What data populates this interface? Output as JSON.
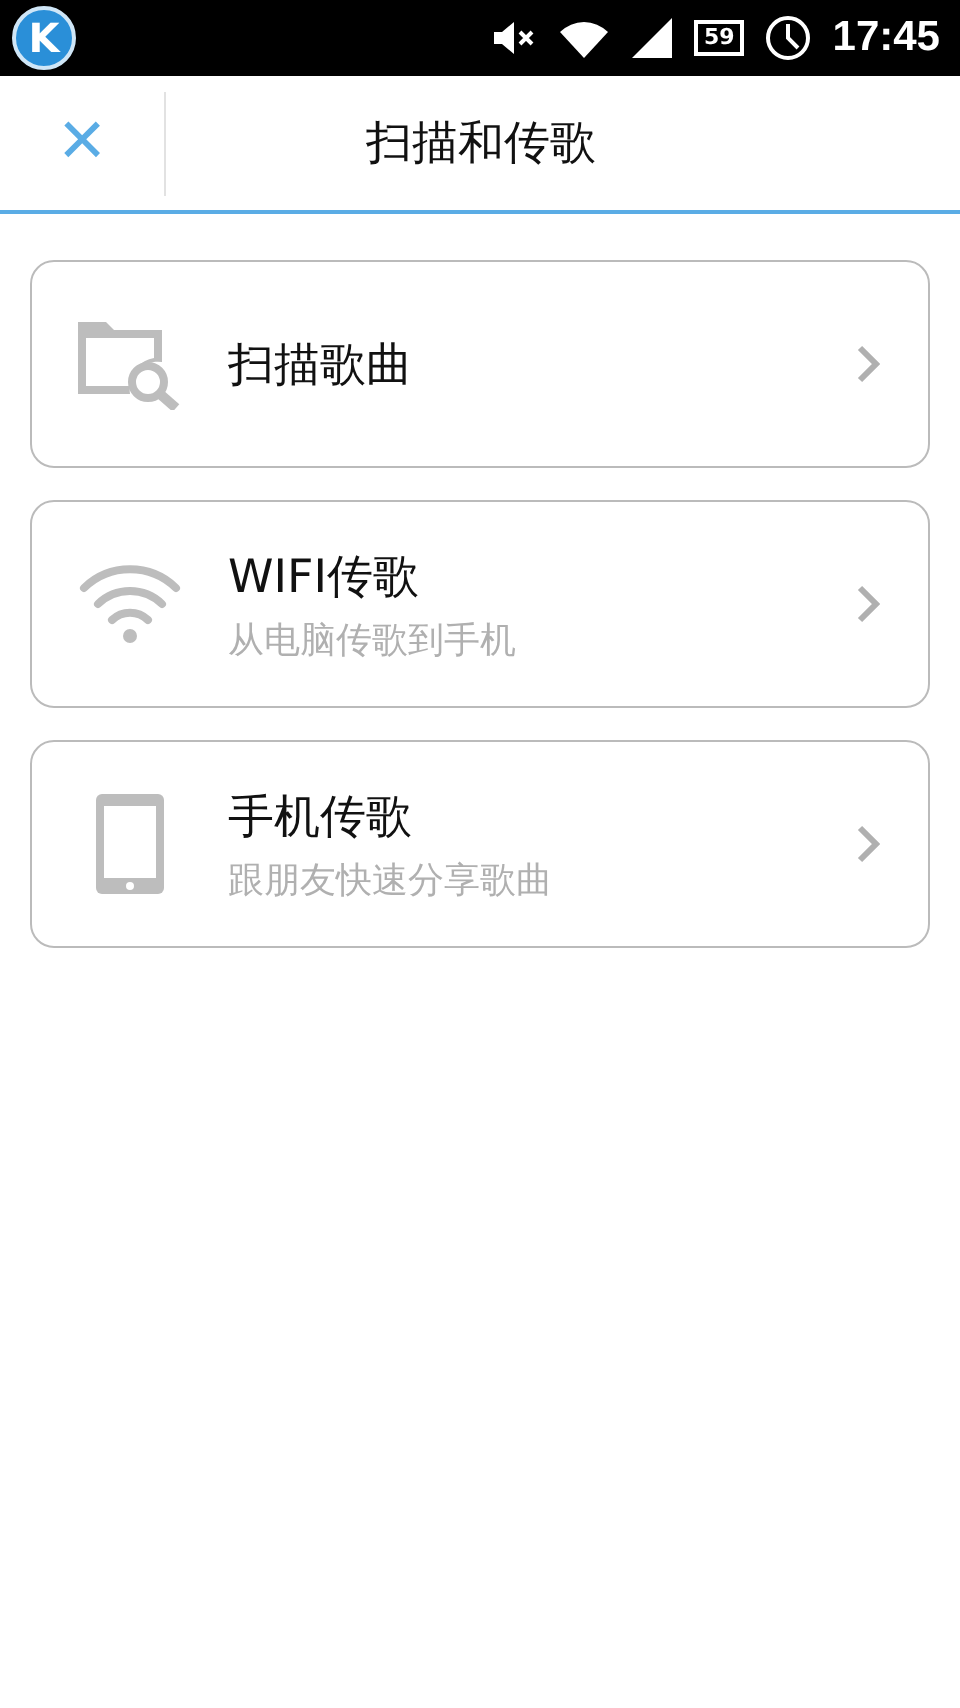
{
  "status_bar": {
    "app_badge": "K",
    "battery": "59",
    "time": "17:45"
  },
  "header": {
    "close": "×",
    "title": "扫描和传歌"
  },
  "items": [
    {
      "kind": "scan",
      "title": "扫描歌曲"
    },
    {
      "kind": "wifi",
      "title": "WIFI传歌",
      "subtitle": "从电脑传歌到手机"
    },
    {
      "kind": "phone",
      "title": "手机传歌",
      "subtitle": "跟朋友快速分享歌曲"
    }
  ]
}
